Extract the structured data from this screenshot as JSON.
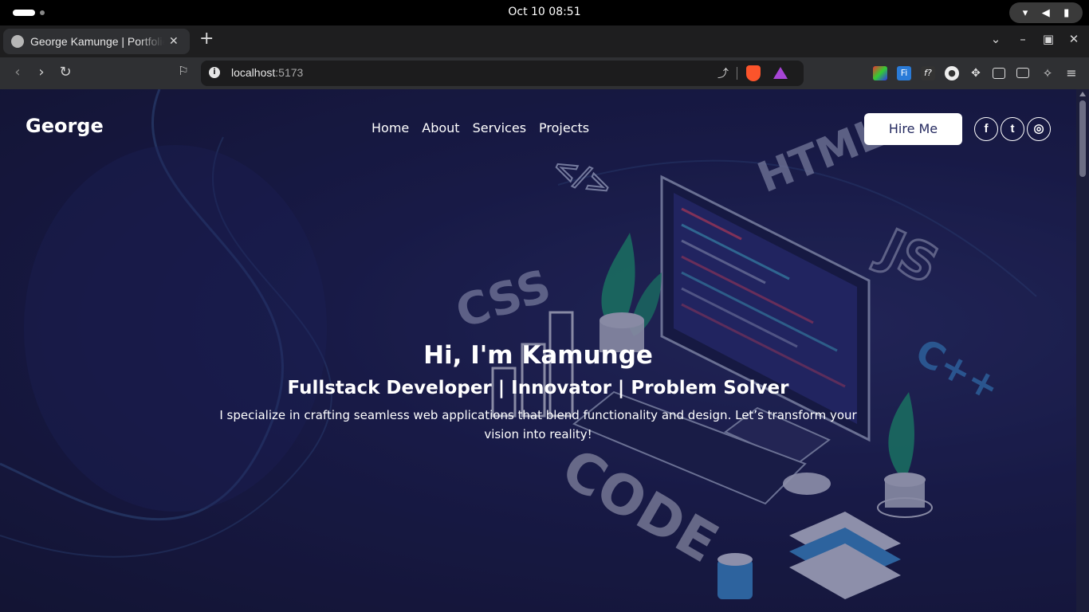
{
  "os": {
    "clock": "Oct 10  08:51",
    "status_icons": [
      "wifi-icon",
      "volume-icon",
      "battery-icon"
    ]
  },
  "browser": {
    "tab_title": "George Kamunge | Portfolio",
    "tab_close": "✕",
    "new_tab": "+",
    "url_host": "localhost",
    "url_port": ":5173",
    "extensions": [
      "color-extension-icon",
      "fi-extension-icon",
      "fx-extension-icon",
      "circle-extension-icon",
      "puzzle-extensions-icon",
      "sidebar-icon",
      "wallet-icon",
      "leo-ai-icon",
      "menu-icon"
    ]
  },
  "site": {
    "brand": "George",
    "nav": [
      "Home",
      "About",
      "Services",
      "Projects"
    ],
    "hire_label": "Hire Me",
    "social": [
      {
        "name": "facebook-icon",
        "glyph": "f"
      },
      {
        "name": "twitter-icon",
        "glyph": "t"
      },
      {
        "name": "instagram-icon",
        "glyph": "◎"
      }
    ],
    "hero": {
      "title": "Hi, I'm Kamunge",
      "subtitle": "Fullstack Developer | Innovator | Problem Solver",
      "description": "I specialize in crafting seamless web applications that blend functionality and design. Let’s transform your vision into reality!"
    },
    "bg_words": [
      "</>",
      "HTML",
      "JS",
      "CSS",
      "C++",
      "CODE"
    ]
  },
  "colors": {
    "page_bg": "#1c1f50",
    "hire_text": "#23285e",
    "leaf": "#1fa37a",
    "accent_blue": "#3d8fd8"
  }
}
